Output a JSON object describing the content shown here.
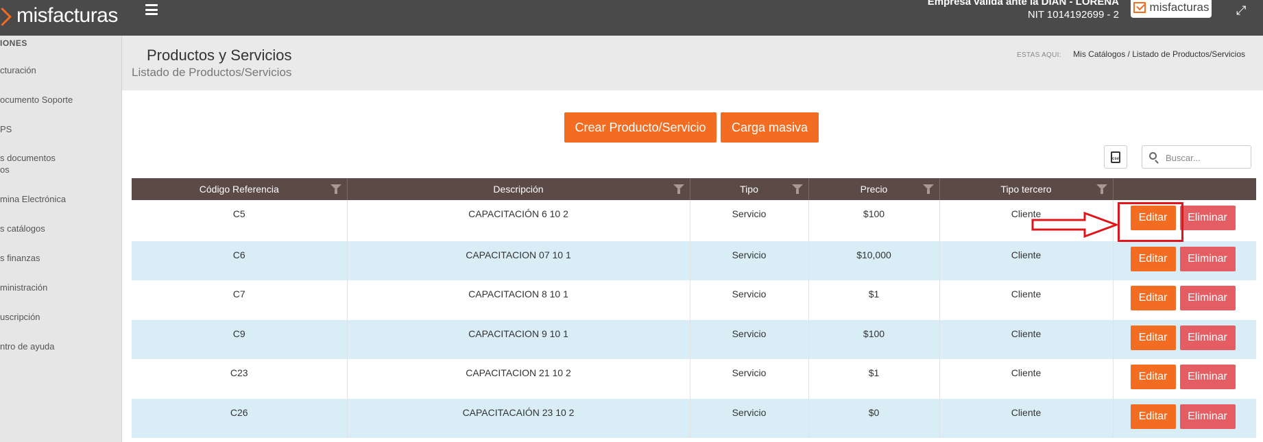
{
  "header": {
    "brand": "misfacturas",
    "company_name": "Empresa válida ante la DIAN - LORENA",
    "company_nit": "NIT 1014192699 - 2",
    "badge_brand": "misfacturas"
  },
  "sidebar": {
    "heading": "IONES",
    "items": [
      {
        "label": "cturación"
      },
      {
        "label": "ocumento Soporte"
      },
      {
        "label": "PS"
      },
      {
        "label": "s documentos\nos"
      },
      {
        "label": "mina Electrónica"
      },
      {
        "label": "s catálogos"
      },
      {
        "label": "s finanzas"
      },
      {
        "label": "ministración"
      },
      {
        "label": "uscripción"
      },
      {
        "label": "ntro de ayuda"
      }
    ]
  },
  "page": {
    "title": "Productos y Servicios",
    "subtitle": "Listado de Productos/Servicios",
    "breadcrumb_label": "ESTAS AQUI:",
    "breadcrumb_root": "Mis Catálogos",
    "breadcrumb_sep": "/",
    "breadcrumb_current": "Listado de Productos/Servicios"
  },
  "toolbar": {
    "create_label": "Crear Producto/Servicio",
    "bulk_label": "Carga masiva",
    "search_placeholder": "Buscar..."
  },
  "table": {
    "headers": [
      "Código Referencia",
      "Descripción",
      "Tipo",
      "Precio",
      "Tipo tercero",
      ""
    ],
    "edit_label": "Editar",
    "delete_label": "Eliminar",
    "rows": [
      {
        "code": "C5",
        "description": "CAPACITACIÓN 6 10 2",
        "type": "Servicio",
        "price": "$100",
        "third_party": "Cliente"
      },
      {
        "code": "C6",
        "description": "CAPACITACION 07 10 1",
        "type": "Servicio",
        "price": "$10,000",
        "third_party": "Cliente"
      },
      {
        "code": "C7",
        "description": "CAPACITACION 8 10 1",
        "type": "Servicio",
        "price": "$1",
        "third_party": "Cliente"
      },
      {
        "code": "C9",
        "description": "CAPACITACION 9 10 1",
        "type": "Servicio",
        "price": "$100",
        "third_party": "Cliente"
      },
      {
        "code": "C23",
        "description": "CAPACITACION 21 10 2",
        "type": "Servicio",
        "price": "$1",
        "third_party": "Cliente"
      },
      {
        "code": "C26",
        "description": "CAPACITACAIÓN 23 10 2",
        "type": "Servicio",
        "price": "$0",
        "third_party": "Cliente"
      }
    ]
  },
  "colors": {
    "accent": "#f26c21",
    "table_header": "#5b4a46",
    "row_alt": "#d9edf7",
    "danger": "#e35d63",
    "annotation": "#e0141b"
  }
}
